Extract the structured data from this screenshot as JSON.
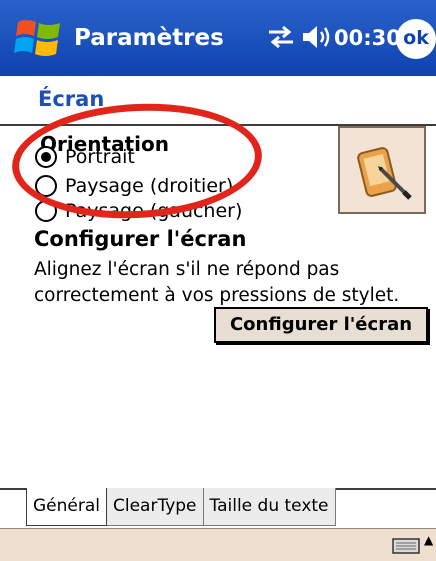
{
  "titlebar": {
    "app_title": "Paramètres",
    "time": "00:30",
    "ok_label": "ok",
    "start_icon": "windows-flag-icon",
    "connectivity_icon": "connectivity-icon",
    "volume_icon": "speaker-icon"
  },
  "page": {
    "section_title": "Écran"
  },
  "orientation": {
    "label": "Orientation",
    "options": [
      {
        "label": "Portrait",
        "selected": true
      },
      {
        "label": "Paysage (droitier)",
        "selected": false
      },
      {
        "label": "Paysage (gaucher)",
        "selected": false
      }
    ]
  },
  "configure": {
    "heading": "Configurer l'écran",
    "description": "Alignez l'écran s'il ne répond pas correctement à vos pressions de stylet.",
    "button_label": "Configurer l'écran"
  },
  "tabs": [
    {
      "label": "Général",
      "active": true
    },
    {
      "label": "ClearType",
      "active": false
    },
    {
      "label": "Taille du texte",
      "active": false
    }
  ],
  "menubar": {
    "input_icon": "keyboard-icon"
  },
  "colors": {
    "titlebar": "#0e43b0",
    "section_title": "#1e4fb4",
    "highlight": "#e1251b",
    "menubar": "#eedfcf"
  }
}
